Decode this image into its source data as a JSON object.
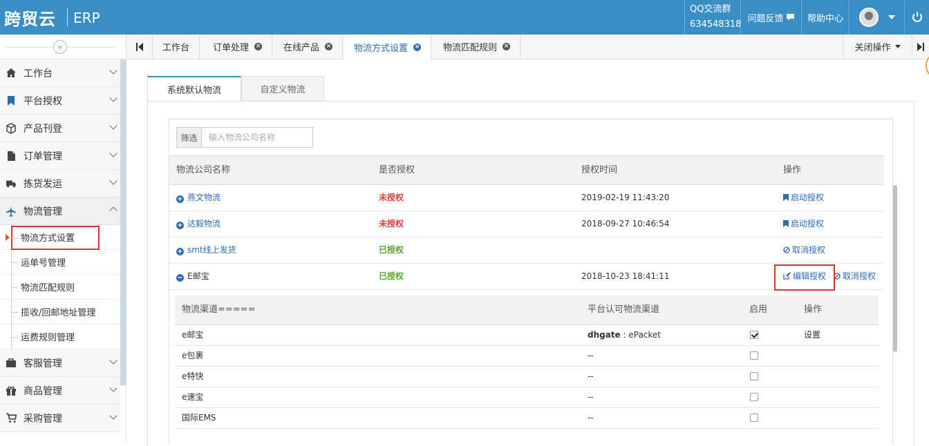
{
  "app": {
    "logo": "跨贸云",
    "product": "ERP"
  },
  "topbar": {
    "qq_label": "QQ交流群",
    "qq_number": "634548318",
    "feedback": "问题反馈",
    "help": "帮助中心"
  },
  "sidebar": {
    "collapse_icon": "«",
    "menu": [
      {
        "label": "工作台",
        "icon": "home-icon"
      },
      {
        "label": "平台授权",
        "icon": "bookmark-icon"
      },
      {
        "label": "产品刊登",
        "icon": "box-icon"
      },
      {
        "label": "订单管理",
        "icon": "document-icon"
      },
      {
        "label": "拣货发运",
        "icon": "truck-icon"
      },
      {
        "label": "物流管理",
        "icon": "plane-icon"
      }
    ],
    "submenu": [
      {
        "label": "物流方式设置"
      },
      {
        "label": "运单号管理"
      },
      {
        "label": "物流匹配规则"
      },
      {
        "label": "揽收/回邮地址管理"
      },
      {
        "label": "运费规则管理"
      }
    ],
    "menu_bottom": [
      {
        "label": "客服管理",
        "icon": "briefcase-icon"
      },
      {
        "label": "商品管理",
        "icon": "gift-icon"
      },
      {
        "label": "采购管理",
        "icon": "cart-icon"
      }
    ]
  },
  "tabs": [
    {
      "label": "工作台",
      "closable": false
    },
    {
      "label": "订单处理",
      "closable": true
    },
    {
      "label": "在线产品",
      "closable": true
    },
    {
      "label": "物流方式设置",
      "closable": true,
      "active": true
    },
    {
      "label": "物流匹配规则",
      "closable": true
    }
  ],
  "tab_ops": "关闭操作",
  "subtabs": [
    {
      "label": "系统默认物流",
      "active": true
    },
    {
      "label": "自定义物流"
    }
  ],
  "filter": {
    "label": "筛选",
    "placeholder": "输入物流公司名称"
  },
  "table": {
    "headers": [
      "物流公司名称",
      "是否授权",
      "授权时间",
      "操作"
    ],
    "rows": [
      {
        "name": "燕文物流",
        "status": "未授权",
        "time": "2019-02-19 11:43:20",
        "op1": "启动授权",
        "op2": ""
      },
      {
        "name": "达毅物流",
        "status": "未授权",
        "time": "2018-09-27 10:46:54",
        "op1": "启动授权",
        "op2": ""
      },
      {
        "name": "smt线上发货",
        "status": "已授权",
        "time": "",
        "op1": "取消授权",
        "op2": ""
      },
      {
        "name": "E邮宝",
        "status": "已授权",
        "time": "2018-10-23 18:41:11",
        "op1": "编辑授权",
        "op2": "取消授权"
      }
    ]
  },
  "channels": {
    "headers": [
      "物流渠道=====",
      "平台认可物流渠道",
      "启用",
      "操作"
    ],
    "rows": [
      {
        "name": "e邮宝",
        "platform": "dhgate",
        "platform_channel": "ePacket",
        "enabled": true,
        "op": "设置"
      },
      {
        "name": "e包裹",
        "platform": "",
        "platform_channel": "--",
        "enabled": false,
        "op": ""
      },
      {
        "name": "e特快",
        "platform": "",
        "platform_channel": "--",
        "enabled": false,
        "op": ""
      },
      {
        "name": "e速宝",
        "platform": "",
        "platform_channel": "--",
        "enabled": false,
        "op": ""
      },
      {
        "name": "国际EMS",
        "platform": "",
        "platform_channel": "--",
        "enabled": false,
        "op": ""
      }
    ]
  },
  "colors": {
    "topbar": "#3a8ec6",
    "link": "#2a6db5",
    "unauthorized": "#e0413a",
    "authorized": "#5aa833",
    "highlight": "#d9342b"
  }
}
